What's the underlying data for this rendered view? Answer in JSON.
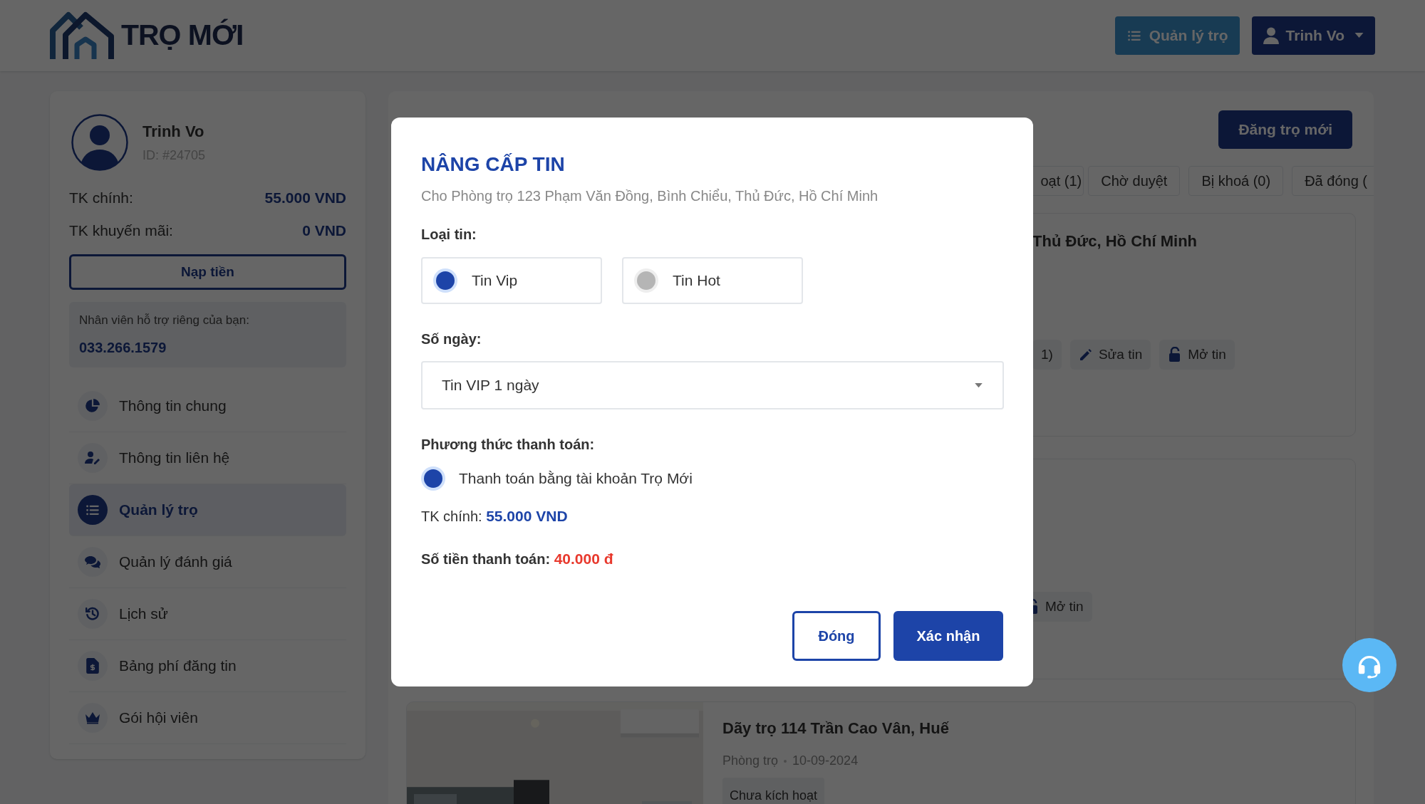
{
  "header": {
    "logo_text": "TRỌ MỚI",
    "buttons": [
      {
        "label": "Quản lý trọ",
        "kind": "manage"
      },
      {
        "label": "Trinh Vo",
        "kind": "user"
      }
    ]
  },
  "sidebar": {
    "user": {
      "name": "Trinh Vo",
      "id": "ID: #24705"
    },
    "balances": [
      {
        "label": "TK chính:",
        "value": "55.000 VND"
      },
      {
        "label": "TK khuyến mãi:",
        "value": "0 VND"
      }
    ],
    "topup_button": "Nạp tiền",
    "support": {
      "label": "Nhân viên hỗ trợ riêng của bạn:",
      "phone": "033.266.1579"
    },
    "menu": [
      {
        "label": "Thông tin chung",
        "kind": "pie",
        "selected": false
      },
      {
        "label": "Thông tin liên hệ",
        "kind": "user-edit",
        "selected": false
      },
      {
        "label": "Quản lý trọ",
        "kind": "list",
        "selected": true
      },
      {
        "label": "Quản lý đánh giá",
        "kind": "chat",
        "selected": false
      },
      {
        "label": "Lịch sử",
        "kind": "history",
        "selected": false
      },
      {
        "label": "Bảng phí đăng tin",
        "kind": "invoice",
        "selected": false
      },
      {
        "label": "Gói hội viên",
        "kind": "crown",
        "selected": false
      }
    ]
  },
  "main": {
    "new_button": "Đăng trọ mới",
    "tabs": [
      {
        "label": "oạt (1)",
        "selected": false
      },
      {
        "label": "Chờ duyệt",
        "selected": false
      },
      {
        "label": "Bị khoá (0)",
        "selected": false
      },
      {
        "label": "Đã đóng (",
        "selected": false
      }
    ],
    "listings": [
      {
        "title": "Thủ Đức, Hồ Chí Minh",
        "actions": [
          {
            "label": "1)",
            "kind": "plain"
          },
          {
            "label": "Sửa tin",
            "kind": "pencil"
          },
          {
            "label": "Mở tin",
            "kind": "unlock"
          }
        ]
      },
      {
        "actions": [
          {
            "label": "Mở tin",
            "kind": "unlock"
          }
        ]
      },
      {
        "title": "Dãy trọ 114 Trần Cao Vân, Huế",
        "category": "Phòng trọ",
        "date": "10-09-2024",
        "status": "Chưa kích hoạt"
      }
    ]
  },
  "modal": {
    "title": "NÂNG CẤP TIN",
    "subtitle": "Cho Phòng trọ 123 Phạm Văn Đồng, Bình Chiểu, Thủ Đức, Hồ Chí Minh",
    "type_label": "Loại tin:",
    "types": [
      {
        "label": "Tin Vip",
        "selected": true
      },
      {
        "label": "Tin Hot",
        "selected": false
      }
    ],
    "days_label": "Số ngày:",
    "days_value": "Tin VIP 1 ngày",
    "payment_label": "Phương thức thanh toán:",
    "payment_methods": [
      {
        "label": "Thanh toán bằng tài khoản Trọ Mới",
        "selected": true
      }
    ],
    "balance_label": "TK chính:",
    "balance_value": "55.000 VND",
    "amount_label": "Số tiền thanh toán:",
    "amount_value": "40.000 đ",
    "buttons": [
      {
        "label": "Đóng",
        "kind": "secondary"
      },
      {
        "label": "Xác nhận",
        "kind": "primary"
      }
    ]
  }
}
